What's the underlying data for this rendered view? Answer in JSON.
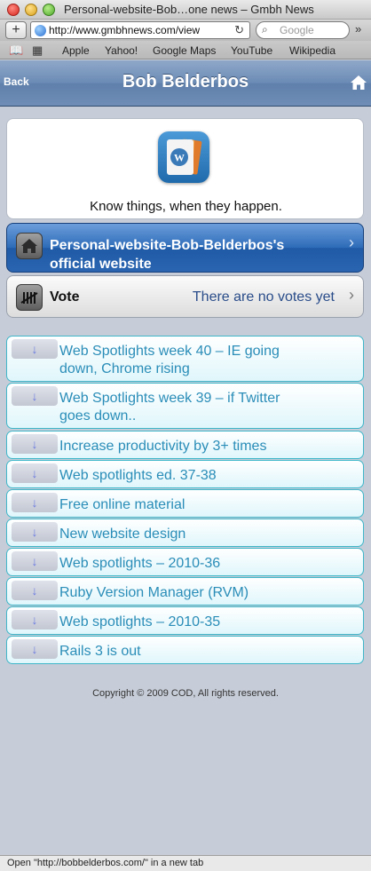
{
  "window": {
    "title": "Personal-website-Bob…one news – Gmbh News"
  },
  "toolbar": {
    "url": "http://www.gmbhnews.com/view",
    "search_placeholder": "Google"
  },
  "bookmarks": [
    "Apple",
    "Yahoo!",
    "Google Maps",
    "YouTube",
    "Wikipedia"
  ],
  "header": {
    "back_label": "Back",
    "title": "Bob Belderbos"
  },
  "logo": {
    "tagline": "Know things, when they happen."
  },
  "website_link": {
    "label": "Personal-website-Bob-Belderbos's official website"
  },
  "vote": {
    "label": "Vote",
    "status": "There are no votes yet"
  },
  "news": [
    {
      "title": "Web Spotlights week 40 – IE going down, Chrome rising"
    },
    {
      "title": "Web Spotlights week 39 – if Twitter goes down.."
    },
    {
      "title": "Increase productivity by 3+ times"
    },
    {
      "title": "Web spotlights ed. 37-38"
    },
    {
      "title": "Free online material"
    },
    {
      "title": "New website design"
    },
    {
      "title": "Web spotlights – 2010-36"
    },
    {
      "title": "Ruby Version Manager (RVM)"
    },
    {
      "title": "Web spotlights – 2010-35"
    },
    {
      "title": "Rails 3 is out"
    }
  ],
  "footer": {
    "copyright": "Copyright © 2009 COD, All rights reserved."
  },
  "statusbar": {
    "text": "Open \"http://bobbelderbos.com/\" in a new tab"
  }
}
